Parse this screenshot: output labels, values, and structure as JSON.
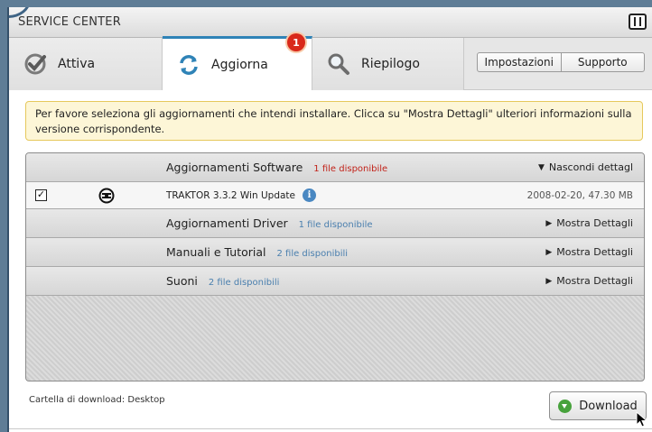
{
  "window": {
    "title": "SERVICE CENTER",
    "logo": "native-instruments-logo"
  },
  "tabs": [
    {
      "label": "Attiva",
      "icon": "checkmark-icon"
    },
    {
      "label": "Aggiorna",
      "icon": "refresh-icon",
      "active": true,
      "badge": "1"
    },
    {
      "label": "Riepilogo",
      "icon": "magnifier-icon"
    }
  ],
  "toolbar": {
    "settings_label": "Impostazioni",
    "support_label": "Supporto"
  },
  "info_message": "Per favore seleziona gli aggiornamenti che intendi installare. Clicca su \"Mostra Dettagli\" ulteriori informazioni sulla versione corrispondente.",
  "categories": [
    {
      "name": "Aggiornamenti Software",
      "count": "1 file disponibile",
      "toggle": "Nascondi dettagl",
      "expanded": true,
      "count_color": "#c2231a"
    },
    {
      "name": "Aggiornamenti Driver",
      "count": "1 file disponibile",
      "toggle": "Mostra Dettagli",
      "expanded": false,
      "count_color": "#4a7fae"
    },
    {
      "name": "Manuali e Tutorial",
      "count": "2 file disponibili",
      "toggle": "Mostra Dettagli",
      "expanded": false,
      "count_color": "#4a7fae"
    },
    {
      "name": "Suoni",
      "count": "2 file disponibili",
      "toggle": "Mostra Dettagli",
      "expanded": false,
      "count_color": "#4a7fae"
    }
  ],
  "items": [
    {
      "name": "TRAKTOR 3.3.2 Win Update",
      "meta": "2008-02-20, 47.30 MB",
      "checked": true,
      "icon": "traktor-icon"
    }
  ],
  "footer": {
    "download_folder": "Cartella di download: Desktop",
    "download_label": "Download"
  },
  "colors": {
    "accent": "#2f83b7",
    "badge": "#d9281a",
    "download_icon": "#47a23c",
    "info_bg": "#fdf6d7"
  }
}
